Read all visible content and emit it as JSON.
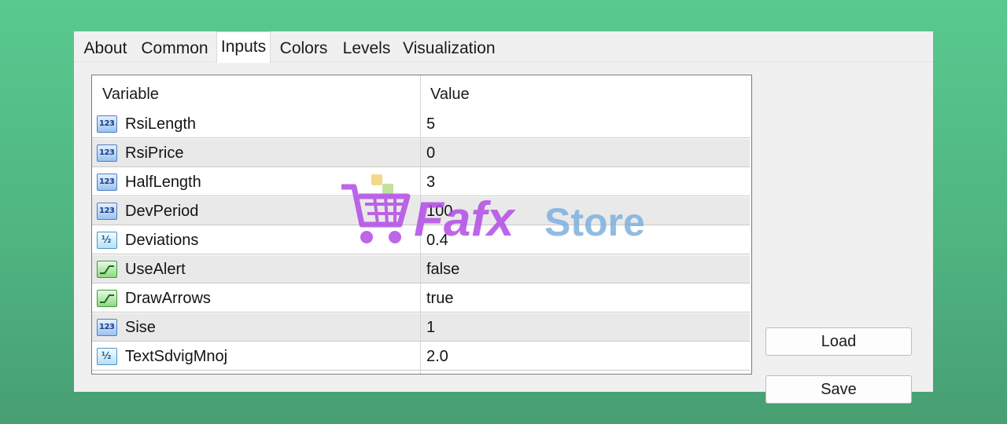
{
  "tabs": [
    "About",
    "Common",
    "Inputs",
    "Colors",
    "Levels",
    "Visualization"
  ],
  "active_tab": "Inputs",
  "table": {
    "headers": {
      "variable": "Variable",
      "value": "Value"
    },
    "rows": [
      {
        "icon": "integer-icon",
        "name": "RsiLength",
        "value": "5"
      },
      {
        "icon": "integer-icon",
        "name": "RsiPrice",
        "value": "0"
      },
      {
        "icon": "integer-icon",
        "name": "HalfLength",
        "value": "3"
      },
      {
        "icon": "integer-icon",
        "name": "DevPeriod",
        "value": "100"
      },
      {
        "icon": "double-icon",
        "name": "Deviations",
        "value": "0.4"
      },
      {
        "icon": "bool-icon",
        "name": "UseAlert",
        "value": "false"
      },
      {
        "icon": "bool-icon",
        "name": "DrawArrows",
        "value": "true"
      },
      {
        "icon": "integer-icon",
        "name": "Sise",
        "value": "1"
      },
      {
        "icon": "double-icon",
        "name": "TextSdvigMnoj",
        "value": "2.0"
      }
    ]
  },
  "buttons": {
    "load": "Load",
    "save": "Save"
  },
  "watermark": {
    "brand": "Fafx",
    "suffix": "Store"
  },
  "colors": {
    "background": "#4fb581",
    "accent_purple": "#b24ce6",
    "accent_blue": "#7fb0df"
  }
}
